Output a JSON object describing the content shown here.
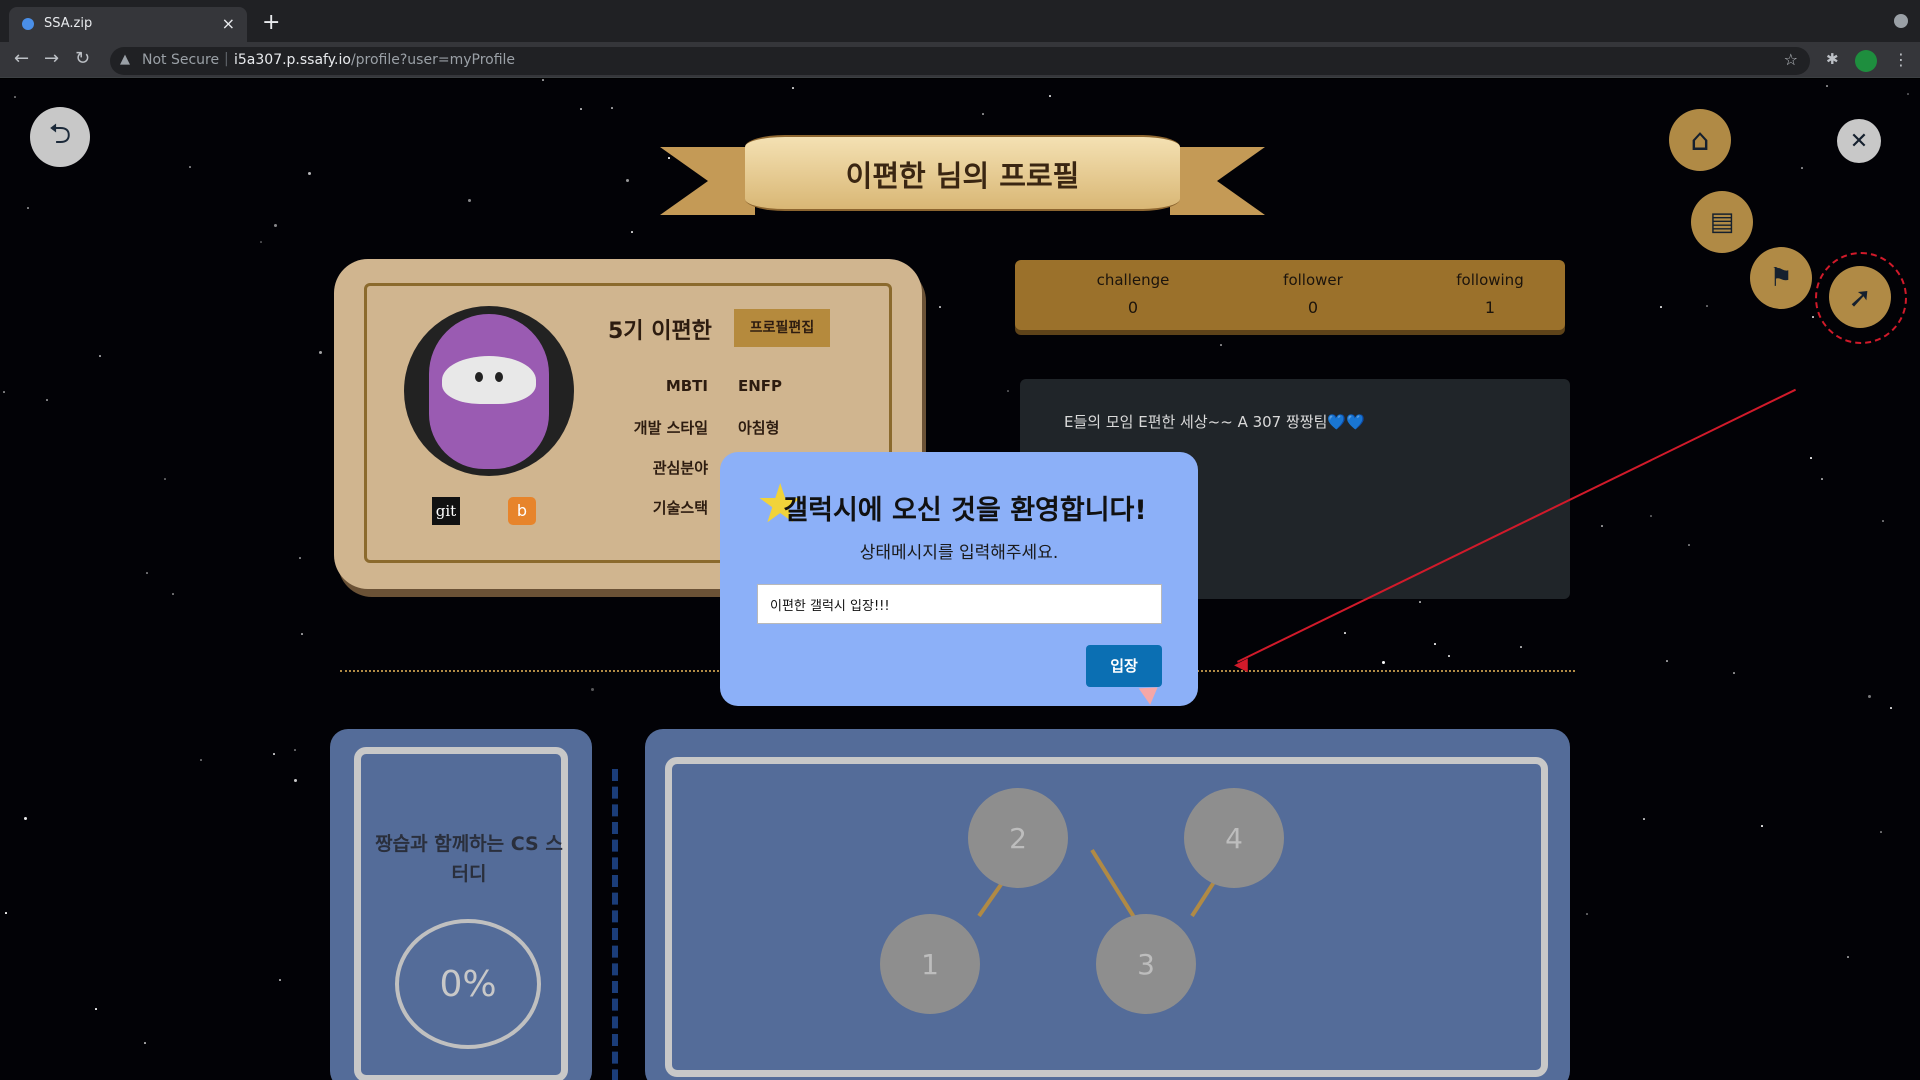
{
  "browser": {
    "tab_title": "SSA.zip",
    "security_label": "Not Secure",
    "url_host": "i5a307.p.ssafy.io",
    "url_path": "/profile?user=myProfile"
  },
  "banner": {
    "title": "이편한 님의 프로필"
  },
  "profile": {
    "name": "5기 이편한",
    "edit_label": "프로필편집",
    "fields": [
      {
        "label": "MBTI",
        "value": "ENFP"
      },
      {
        "label": "개발 스타일",
        "value": "아침형"
      },
      {
        "label": "관심분야",
        "value": ""
      },
      {
        "label": "기술스택",
        "value": ""
      }
    ],
    "links": {
      "git": "git",
      "blog": "b"
    }
  },
  "stats": {
    "challenge_label": "challenge",
    "challenge_value": "0",
    "follower_label": "follower",
    "follower_value": "0",
    "following_label": "following",
    "following_value": "1"
  },
  "status_message": "E들의 모임 E편한 세상~~ A 307 짱짱팀💙💙",
  "study": {
    "title": "짱습과 함께하는 CS 스터디",
    "progress": "0%",
    "nodes": [
      "1",
      "2",
      "3",
      "4"
    ]
  },
  "modal": {
    "title": "갤럭시에 오신 것을 환영합니다!",
    "subtitle": "상태메시지를 입력해주세요.",
    "input_value": "이편한 갤럭시 입장!!!",
    "enter_label": "입장"
  },
  "icons": {
    "back": "back-arrow-icon",
    "home": "home-icon",
    "card": "id-card-icon",
    "flag": "flag-icon",
    "rocket": "rocket-icon",
    "close": "close-icon",
    "star": "star-icon"
  },
  "colors": {
    "gold": "#b08a45",
    "modal_bg": "#8cb0f8",
    "ticket": "#546c99",
    "annotation": "#d11a2a"
  }
}
